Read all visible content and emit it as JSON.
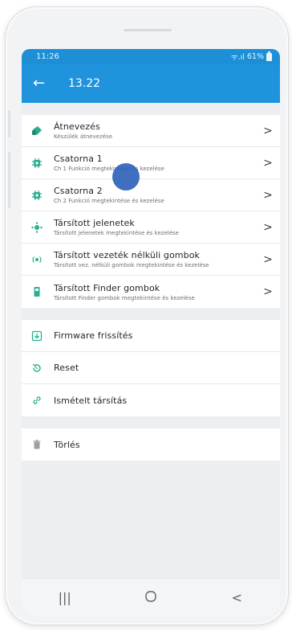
{
  "status_bar": {
    "time": "11:26",
    "signal": "ᯤ.ıl",
    "battery_percent": "61%"
  },
  "app_bar": {
    "title": "13.22"
  },
  "section1": [
    {
      "title": "Átnevezés",
      "subtitle": "Készülék átnevezése",
      "icon": "tag-icon"
    },
    {
      "title": "Csatorna 1",
      "subtitle": "Ch 1 Funkció megtekintése és kezelése",
      "icon": "chip-icon"
    },
    {
      "title": "Csatorna 2",
      "subtitle": "Ch 2 Funkció megtekintése és kezelése",
      "icon": "chip-icon"
    },
    {
      "title": "Társított jelenetek",
      "subtitle": "Társított jelenetek megtekintése és kezelése",
      "icon": "scene-icon"
    },
    {
      "title": "Társított vezeték nélküli gombok",
      "subtitle": "Társított vez. nélküli gombok megtekintése és kezelése",
      "icon": "wireless-icon"
    },
    {
      "title": "Társított Finder gombok",
      "subtitle": "Társított Finder gombok megtekintése és kezelése",
      "icon": "finder-remote-icon"
    }
  ],
  "section2": [
    {
      "title": "Firmware frissítés",
      "icon": "download-icon"
    },
    {
      "title": "Reset",
      "icon": "reset-icon"
    },
    {
      "title": "Ismételt társítás",
      "icon": "link-icon"
    }
  ],
  "section3": [
    {
      "title": "Törlés",
      "icon": "trash-icon"
    }
  ],
  "colors": {
    "primary": "#1f94dc",
    "accent": "#27b08f",
    "touch": "#2f63b8"
  }
}
